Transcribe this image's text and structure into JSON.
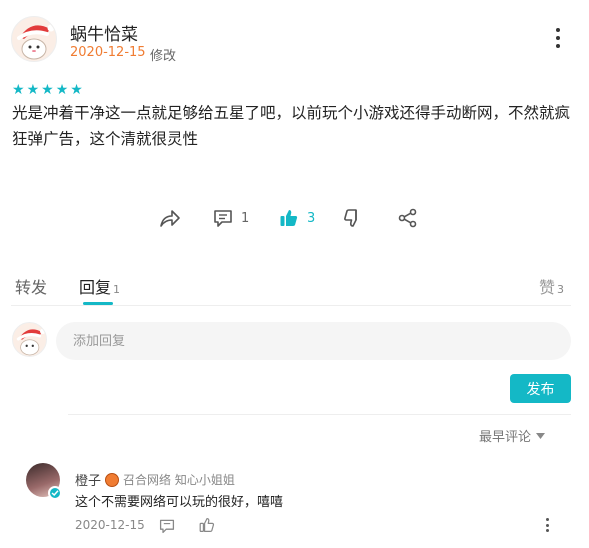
{
  "post": {
    "username": "蜗牛恰菜",
    "date": "2020-12-15",
    "edited_label": "修改",
    "rating": 5,
    "review_text": "光是冲着干净这一点就足够给五星了吧，以前玩个小游戏还得手动断网，不然就疯狂弹广告，这个清就很灵性",
    "actions": {
      "comment_count": "1",
      "like_count": "3"
    }
  },
  "tabs": {
    "repost": "转发",
    "reply": "回复",
    "reply_count": "1",
    "likes": "赞",
    "likes_count": "3"
  },
  "reply_box": {
    "placeholder": "添加回复",
    "post_button": "发布"
  },
  "sort": {
    "label": "最早评论"
  },
  "comment": {
    "username": "橙子",
    "tag": "召合网络 知心小姐姐",
    "text": "这个不需要网络可以玩的很好，嘻嘻",
    "date": "2020-12-15"
  },
  "colors": {
    "accent": "#14b8c6",
    "date_orange": "#f07c32"
  }
}
